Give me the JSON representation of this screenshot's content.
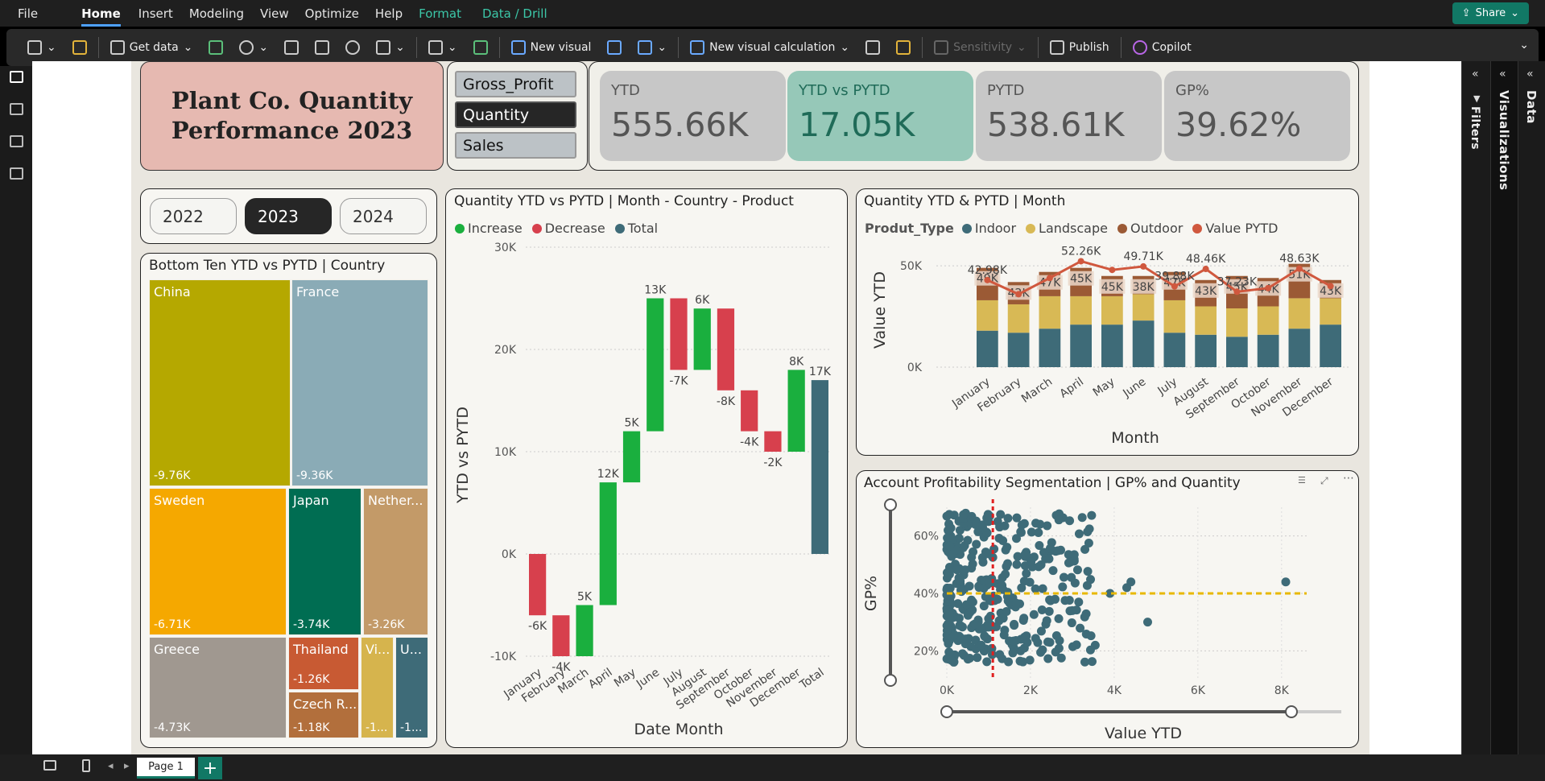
{
  "menu": {
    "items": [
      "File",
      "Home",
      "Insert",
      "Modeling",
      "View",
      "Optimize",
      "Help",
      "Format",
      "Data / Drill"
    ],
    "share": "Share"
  },
  "ribbon": {
    "get_data": "Get data",
    "new_visual": "New visual",
    "new_calc": "New visual calculation",
    "sensitivity": "Sensitivity",
    "publish": "Publish",
    "copilot": "Copilot"
  },
  "side": {
    "filters": "Filters",
    "visualizations": "Visualizations",
    "data": "Data"
  },
  "pages": {
    "page1": "Page 1",
    "add": "+"
  },
  "title": {
    "line1": "Plant Co. Quantity",
    "line2": "Performance 2023"
  },
  "measures": [
    "Gross_Profit",
    "Quantity",
    "Sales"
  ],
  "kpis": [
    {
      "label": "YTD",
      "value": "555.66K"
    },
    {
      "label": "YTD vs PYTD",
      "value": "17.05K"
    },
    {
      "label": "PYTD",
      "value": "538.61K"
    },
    {
      "label": "GP%",
      "value": "39.62%"
    }
  ],
  "years": [
    "2022",
    "2023",
    "2024"
  ],
  "treemap": {
    "title": "Bottom Ten YTD vs PYTD | Country",
    "items": [
      {
        "name": "China",
        "value": "-9.76K",
        "color": "#b5a800"
      },
      {
        "name": "France",
        "value": "-9.36K",
        "color": "#8aabb6"
      },
      {
        "name": "Sweden",
        "value": "-6.71K",
        "color": "#f5a800"
      },
      {
        "name": "Japan",
        "value": "-3.74K",
        "color": "#006d52"
      },
      {
        "name": "Nether...",
        "value": "-3.26K",
        "color": "#c39a68"
      },
      {
        "name": "Greece",
        "value": "-4.73K",
        "color": "#a09890"
      },
      {
        "name": "Thailand",
        "value": "-1.26K",
        "color": "#c85a33"
      },
      {
        "name": "Czech R...",
        "value": "-1.18K",
        "color": "#b26f3c"
      },
      {
        "name": "Vi...",
        "value": "-1...",
        "color": "#d6b44d"
      },
      {
        "name": "U...",
        "value": "-1...",
        "color": "#3e6b78"
      }
    ]
  },
  "chart_data": [
    {
      "type": "waterfall",
      "title": "Quantity YTD vs PYTD | Month - Country - Product",
      "xlabel": "Date Month",
      "ylabel": "YTD vs PYTD",
      "legend": [
        "Increase",
        "Decrease",
        "Total"
      ],
      "categories": [
        "January",
        "February",
        "March",
        "April",
        "May",
        "June",
        "July",
        "August",
        "September",
        "October",
        "November",
        "December",
        "Total"
      ],
      "values": [
        -6,
        -4,
        5,
        12,
        5,
        13,
        -7,
        6,
        -8,
        -4,
        -2,
        8,
        17
      ],
      "labels": [
        "-6K",
        "-4K",
        "5K",
        "12K",
        "5K",
        "13K",
        "-7K",
        "6K",
        "-8K",
        "-4K",
        "-2K",
        "8K",
        "17K"
      ],
      "yticks": [
        "30K",
        "20K",
        "10K",
        "0K",
        "-10K"
      ],
      "ylim": [
        -10,
        30
      ],
      "colors": {
        "increase": "#1aaf3e",
        "decrease": "#d7404d",
        "total": "#3e6b78"
      }
    },
    {
      "type": "bar",
      "title": "Quantity YTD & PYTD | Month",
      "xlabel": "Month",
      "ylabel": "Value YTD",
      "legend_title": "Produt_Type",
      "legend": [
        "Indoor",
        "Landscape",
        "Outdoor",
        "Value PYTD"
      ],
      "categories": [
        "January",
        "February",
        "March",
        "April",
        "May",
        "June",
        "July",
        "August",
        "September",
        "October",
        "November",
        "December"
      ],
      "series": [
        {
          "name": "Indoor",
          "values": [
            18,
            17,
            19,
            21,
            21,
            23,
            17,
            16,
            15,
            16,
            19,
            21
          ]
        },
        {
          "name": "Landscape",
          "values": [
            15,
            14,
            16,
            14,
            14,
            13,
            16,
            14,
            14,
            14,
            15,
            13
          ]
        },
        {
          "name": "Outdoor",
          "values": [
            16,
            11,
            12,
            14,
            10,
            9,
            14,
            13,
            16,
            14,
            17,
            9
          ]
        }
      ],
      "totals": [
        "49K",
        "42K",
        "47K",
        "45K",
        "45K",
        "38K",
        "47K",
        "43K",
        "45K",
        "44K",
        "51K",
        "43K"
      ],
      "pytd": [
        42.98,
        36,
        44,
        52.26,
        48,
        49.71,
        39.88,
        48.46,
        37.23,
        39,
        48.63,
        40
      ],
      "pytd_labels": [
        "42.98K",
        "",
        "",
        "52.26K",
        "",
        "49.71K",
        "39.88K",
        "48.46K",
        "37.23K",
        "",
        "48.63K",
        ""
      ],
      "yticks": [
        "50K",
        "0K"
      ],
      "ylim": [
        0,
        60
      ],
      "colors": {
        "Indoor": "#3e6b78",
        "Landscape": "#d8b955",
        "Outdoor": "#9b5a35",
        "Value PYTD": "#d0583e"
      }
    },
    {
      "type": "scatter",
      "title": "Account Profitability Segmentation | GP% and Quantity",
      "xlabel": "Value YTD",
      "ylabel": "GP%",
      "xticks": [
        "0K",
        "2K",
        "4K",
        "6K",
        "8K"
      ],
      "yticks": [
        "60%",
        "40%",
        "20%"
      ],
      "xlim": [
        0,
        8.6
      ],
      "ylim": [
        10,
        70
      ],
      "ref_x": 1.1,
      "ref_y": 40,
      "color": "#3e6b78"
    }
  ]
}
